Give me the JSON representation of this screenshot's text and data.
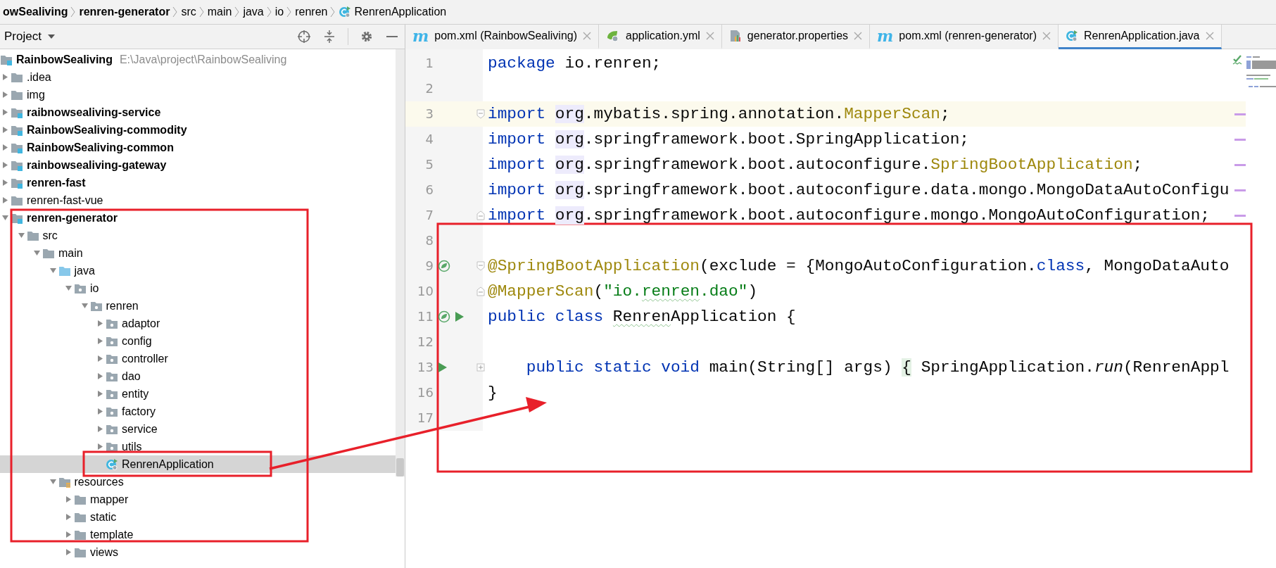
{
  "breadcrumb": [
    {
      "text": "owSealiving",
      "bold": true,
      "kind": "module"
    },
    {
      "text": "renren-generator",
      "bold": true,
      "kind": "module"
    },
    {
      "text": "src",
      "bold": false,
      "kind": "directory"
    },
    {
      "text": "main",
      "bold": false,
      "kind": "directory"
    },
    {
      "text": "java",
      "bold": false,
      "kind": "directory"
    },
    {
      "text": "io",
      "bold": false,
      "kind": "directory"
    },
    {
      "text": "renren",
      "bold": false,
      "kind": "directory"
    },
    {
      "text": "RenrenApplication",
      "bold": false,
      "kind": "class"
    }
  ],
  "project_panel": {
    "title": "Project"
  },
  "tree": [
    {
      "label": "RainbowSealiving",
      "kind": "module",
      "path": "E:\\Java\\project\\RainbowSealiving",
      "selected": false,
      "children": [
        {
          "label": ".idea",
          "kind": "folder",
          "expanded": false,
          "selected": false
        },
        {
          "label": "img",
          "kind": "folder",
          "expanded": false,
          "selected": false
        },
        {
          "label": "raibnowsealiving-service",
          "kind": "module",
          "expanded": false,
          "selected": false
        },
        {
          "label": "RainbowSealiving-commodity",
          "kind": "module",
          "expanded": false,
          "selected": false
        },
        {
          "label": "RainbowSealiving-common",
          "kind": "module",
          "expanded": false,
          "selected": false
        },
        {
          "label": "rainbowsealiving-gateway",
          "kind": "module",
          "expanded": false,
          "selected": false
        },
        {
          "label": "renren-fast",
          "kind": "module",
          "expanded": false,
          "selected": false
        },
        {
          "label": "renren-fast-vue",
          "kind": "folder",
          "expanded": false,
          "selected": false
        },
        {
          "label": "renren-generator",
          "kind": "module",
          "expanded": true,
          "selected": false,
          "children": [
            {
              "label": "src",
              "kind": "folder",
              "expanded": true,
              "selected": false,
              "children": [
                {
                  "label": "main",
                  "kind": "folder",
                  "expanded": true,
                  "selected": false,
                  "children": [
                    {
                      "label": "java",
                      "kind": "source",
                      "expanded": true,
                      "selected": false,
                      "children": [
                        {
                          "label": "io",
                          "kind": "package",
                          "expanded": true,
                          "selected": false,
                          "children": [
                            {
                              "label": "renren",
                              "kind": "package",
                              "expanded": true,
                              "selected": false,
                              "children": [
                                {
                                  "label": "adaptor",
                                  "kind": "package",
                                  "expanded": false,
                                  "selected": false
                                },
                                {
                                  "label": "config",
                                  "kind": "package",
                                  "expanded": false,
                                  "selected": false
                                },
                                {
                                  "label": "controller",
                                  "kind": "package",
                                  "expanded": false,
                                  "selected": false
                                },
                                {
                                  "label": "dao",
                                  "kind": "package",
                                  "expanded": false,
                                  "selected": false
                                },
                                {
                                  "label": "entity",
                                  "kind": "package",
                                  "expanded": false,
                                  "selected": false
                                },
                                {
                                  "label": "factory",
                                  "kind": "package",
                                  "expanded": false,
                                  "selected": false
                                },
                                {
                                  "label": "service",
                                  "kind": "package",
                                  "expanded": false,
                                  "selected": false
                                },
                                {
                                  "label": "utils",
                                  "kind": "package",
                                  "expanded": false,
                                  "selected": false
                                },
                                {
                                  "label": "RenrenApplication",
                                  "kind": "class",
                                  "selected": true
                                }
                              ]
                            }
                          ]
                        }
                      ]
                    },
                    {
                      "label": "resources",
                      "kind": "resources",
                      "expanded": true,
                      "selected": false,
                      "children": [
                        {
                          "label": "mapper",
                          "kind": "folder",
                          "expanded": false,
                          "selected": false
                        },
                        {
                          "label": "static",
                          "kind": "folder",
                          "expanded": false,
                          "selected": false
                        },
                        {
                          "label": "template",
                          "kind": "folder",
                          "expanded": false,
                          "selected": false
                        },
                        {
                          "label": "views",
                          "kind": "folder",
                          "expanded": false,
                          "selected": false
                        }
                      ]
                    }
                  ]
                }
              ]
            }
          ]
        }
      ]
    }
  ],
  "tabs": [
    {
      "label": "pom.xml (RainbowSealiving)",
      "kind": "maven",
      "glyph": "m",
      "selected": false
    },
    {
      "label": "application.yml",
      "kind": "yaml",
      "selected": false
    },
    {
      "label": "generator.properties",
      "kind": "properties",
      "selected": false
    },
    {
      "label": "pom.xml (renren-generator)",
      "kind": "maven",
      "glyph": "m",
      "selected": false
    },
    {
      "label": "RenrenApplication.java",
      "kind": "class",
      "selected": true
    }
  ],
  "editor": {
    "lines": [
      {
        "number": "1",
        "tokens": [
          {
            "text": "package ",
            "kind": "keyword"
          },
          {
            "text": "io.renren;",
            "kind": "plain"
          }
        ]
      },
      {
        "number": "2"
      },
      {
        "number": "3",
        "current": true,
        "fold": {
          "kind": "open"
        },
        "stripe_mark": true,
        "tokens": [
          {
            "text": "import ",
            "kind": "keyword"
          },
          {
            "text": "org",
            "kind": "usage"
          },
          {
            "text": ".mybatis.spring.annotation.",
            "kind": "plain"
          },
          {
            "text": "MapperScan",
            "kind": "annotation"
          },
          {
            "text": ";",
            "kind": "plain"
          }
        ]
      },
      {
        "number": "4",
        "stripe_mark": true,
        "tokens": [
          {
            "text": "import ",
            "kind": "keyword"
          },
          {
            "text": "org",
            "kind": "usage"
          },
          {
            "text": ".springframework.boot.SpringApplication;",
            "kind": "plain"
          }
        ]
      },
      {
        "number": "5",
        "stripe_mark": true,
        "tokens": [
          {
            "text": "import ",
            "kind": "keyword"
          },
          {
            "text": "org",
            "kind": "usage"
          },
          {
            "text": ".springframework.boot.autoconfigure.",
            "kind": "plain"
          },
          {
            "text": "SpringBootApplication",
            "kind": "annotation"
          },
          {
            "text": ";",
            "kind": "plain"
          }
        ]
      },
      {
        "number": "6",
        "stripe_mark": true,
        "tokens": [
          {
            "text": "import ",
            "kind": "keyword"
          },
          {
            "text": "org",
            "kind": "usage"
          },
          {
            "text": ".springframework.boot.autoconfigure.data.mongo.MongoDataAutoConfigu",
            "kind": "plain"
          }
        ]
      },
      {
        "number": "7",
        "fold": {
          "kind": "close"
        },
        "stripe_mark": true,
        "tokens": [
          {
            "text": "import ",
            "kind": "keyword"
          },
          {
            "text": "org",
            "kind": "usage"
          },
          {
            "text": ".springframework.boot.autoconfigure.mongo.MongoAutoConfiguration;",
            "kind": "plain"
          }
        ]
      },
      {
        "number": "8"
      },
      {
        "number": "9",
        "fold": {
          "kind": "open"
        },
        "gutter": [
          {
            "kind": "bean"
          }
        ],
        "tokens": [
          {
            "text": "@SpringBootApplication",
            "kind": "annotation"
          },
          {
            "text": "(exclude = {MongoAutoConfiguration.",
            "kind": "plain"
          },
          {
            "text": "class",
            "kind": "keyword"
          },
          {
            "text": ", MongoDataAuto",
            "kind": "plain"
          }
        ]
      },
      {
        "number": "10",
        "fold": {
          "kind": "close"
        },
        "tokens": [
          {
            "text": "@MapperScan",
            "kind": "annotation"
          },
          {
            "text": "(",
            "kind": "plain"
          },
          {
            "text": "\"io.",
            "kind": "string"
          },
          {
            "text": "renren",
            "kind": "string",
            "typo": true
          },
          {
            "text": ".dao\"",
            "kind": "string"
          },
          {
            "text": ")",
            "kind": "plain"
          }
        ]
      },
      {
        "number": "11",
        "gutter": [
          {
            "kind": "bean"
          },
          {
            "kind": "run"
          }
        ],
        "tokens": [
          {
            "text": "public class ",
            "kind": "keyword"
          },
          {
            "text": "Renren",
            "kind": "plain",
            "typo": true
          },
          {
            "text": "Application {",
            "kind": "plain"
          }
        ]
      },
      {
        "number": "12"
      },
      {
        "number": "13",
        "fold": {
          "kind": "collapsed"
        },
        "gutter": [
          {
            "kind": "run"
          }
        ],
        "tokens": [
          {
            "text": "    public static void",
            "kind": "keyword"
          },
          {
            "text": " main(String[] args) ",
            "kind": "plain"
          },
          {
            "text": "{",
            "kind": "folded"
          },
          {
            "text": " SpringApplication.",
            "kind": "plain"
          },
          {
            "text": "run",
            "kind": "static"
          },
          {
            "text": "(RenrenAppl",
            "kind": "plain"
          }
        ]
      },
      {
        "number": "16",
        "tokens": [
          {
            "text": "}",
            "kind": "plain"
          }
        ]
      },
      {
        "number": "17"
      }
    ]
  },
  "annotations": [
    {
      "kind": "frame"
    },
    {
      "kind": "frame"
    },
    {
      "kind": "frame"
    },
    {
      "kind": "arrow"
    }
  ]
}
